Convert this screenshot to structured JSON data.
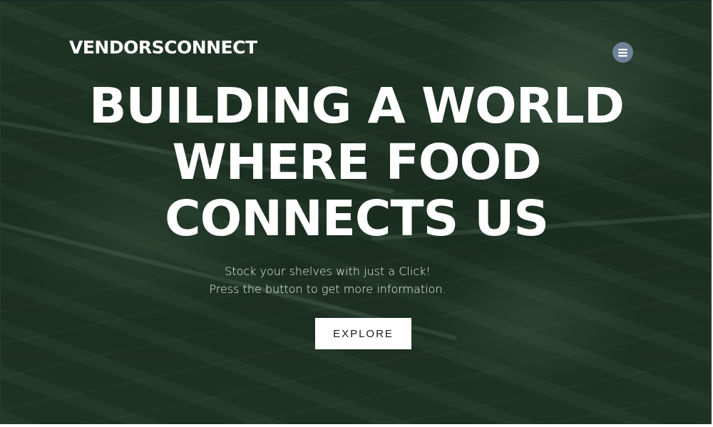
{
  "header": {
    "brand": "VENDORSCONNECT",
    "menu_icon": "hamburger-icon"
  },
  "hero": {
    "headline_lines": [
      "BUILDING A WORLD",
      "WHERE FOOD",
      "CONNECTS US"
    ],
    "subtitle_lines": [
      "Stock your shelves with just a Click!",
      "Press the button to get more information."
    ],
    "cta_label": "EXPLORE"
  },
  "colors": {
    "overlay": "#1e3324",
    "menu_button": "#6f8297",
    "text": "#ffffff",
    "cta_background": "#ffffff"
  }
}
